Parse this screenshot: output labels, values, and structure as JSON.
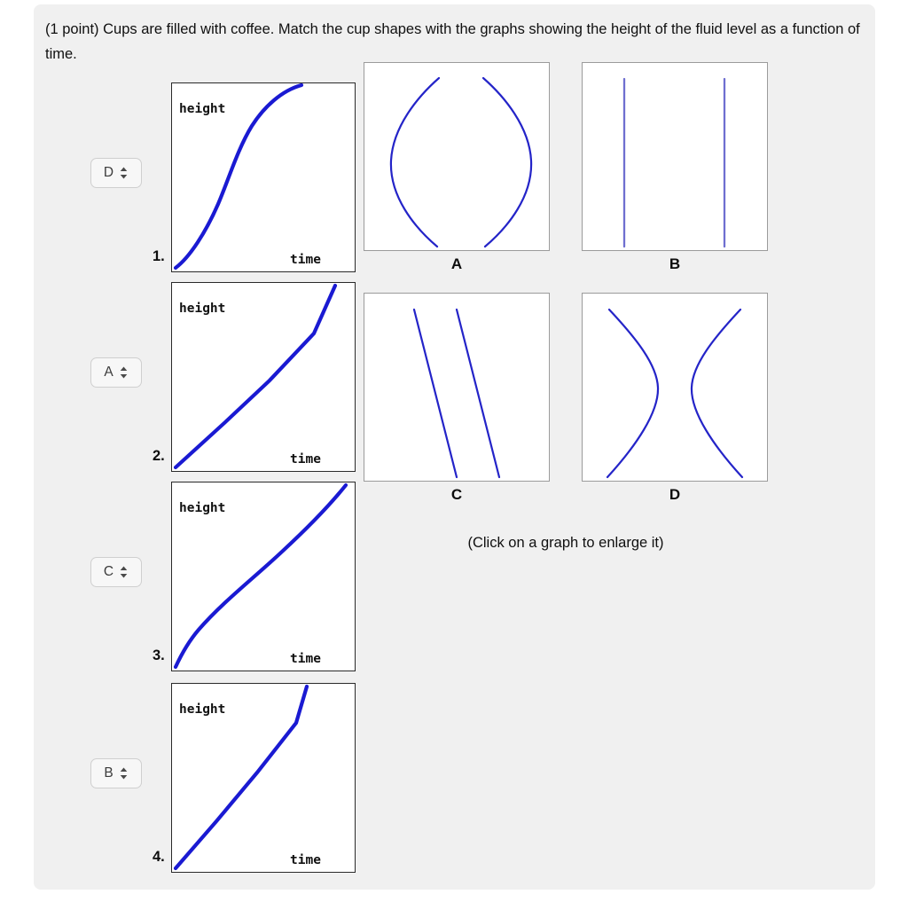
{
  "question": {
    "text": "(1 point) Cups are filled with coffee. Match the cup shapes with the graphs showing the height of the fluid level as a function of time."
  },
  "colors": {
    "curve_blue": "#1a1ad2",
    "cylinder_blue": "#6f6fd0",
    "panel_bg": "#f0f0f0",
    "graph_border": "#2a2a2a",
    "cup_border": "#9b9b9b"
  },
  "matching_rows": [
    {
      "number": "1.",
      "selected": "D",
      "options": [
        "?",
        "A",
        "B",
        "C",
        "D"
      ],
      "graph": {
        "y_label": "height",
        "x_label": "time",
        "shape": "sigmoid",
        "description": "S-shaped curve: slow rise, then steep, then levelling"
      }
    },
    {
      "number": "2.",
      "selected": "A",
      "options": [
        "?",
        "A",
        "B",
        "C",
        "D"
      ],
      "graph": {
        "y_label": "height",
        "x_label": "time",
        "shape": "linear",
        "description": "Straight line of constant slope reaching the top-right corner"
      }
    },
    {
      "number": "3.",
      "selected": "C",
      "options": [
        "?",
        "A",
        "B",
        "C",
        "D"
      ],
      "graph": {
        "y_label": "height",
        "x_label": "time",
        "shape": "concave-up",
        "description": "Gently curving line, slightly concave up, reaching top-right corner"
      }
    },
    {
      "number": "4.",
      "selected": "B",
      "options": [
        "?",
        "A",
        "B",
        "C",
        "D"
      ],
      "graph": {
        "y_label": "height",
        "x_label": "time",
        "shape": "linear-steep",
        "description": "Straight line of steeper slope reaching the top before the right edge"
      }
    }
  ],
  "cups": [
    {
      "label": "A",
      "shape": "bulging-sphere",
      "description": "Cup narrow at top and bottom, bulging wide in the middle"
    },
    {
      "label": "B",
      "shape": "cylinder",
      "description": "Straight vertical sides, constant width"
    },
    {
      "label": "C",
      "shape": "slanted-cylinder",
      "description": "Two parallel slanted straight sides, constant width"
    },
    {
      "label": "D",
      "shape": "hourglass",
      "description": "Cup wide at top and bottom, pinched narrow in the middle"
    }
  ],
  "hint": {
    "text": "(Click on a graph to enlarge it)"
  }
}
